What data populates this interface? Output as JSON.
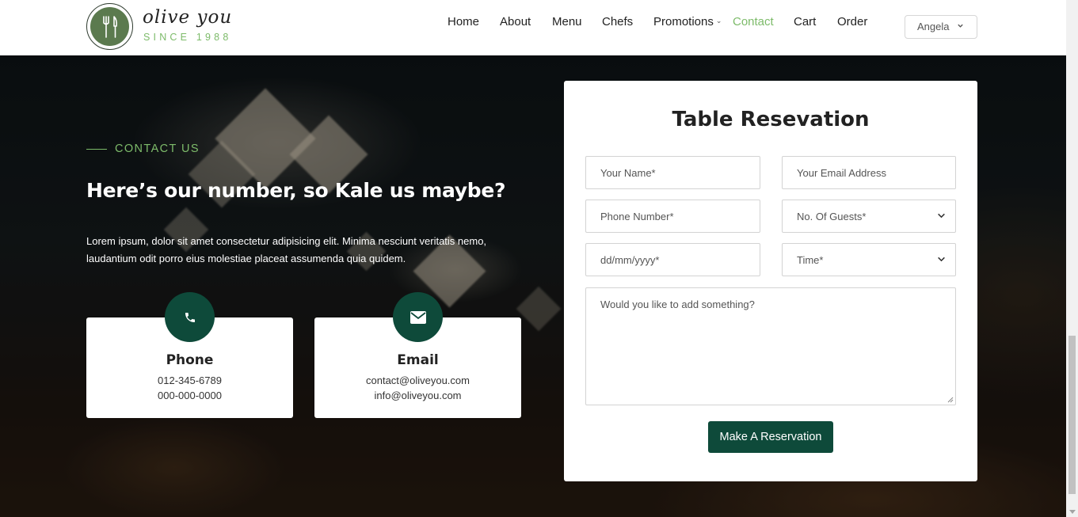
{
  "brand": {
    "name": "olive you",
    "since": "SINCE 1988"
  },
  "nav": {
    "items": [
      {
        "label": "Home"
      },
      {
        "label": "About"
      },
      {
        "label": "Menu"
      },
      {
        "label": "Chefs"
      },
      {
        "label": "Promotions",
        "has_dropdown": true
      },
      {
        "label": "Contact",
        "active": true
      },
      {
        "label": "Cart"
      },
      {
        "label": "Order"
      }
    ],
    "user_select": "Angela"
  },
  "contact": {
    "eyebrow": "CONTACT US",
    "headline": "Here’s our number, so Kale us maybe?",
    "description": "Lorem ipsum, dolor sit amet consectetur adipisicing elit. Minima nesciunt veritatis nemo, laudantium odit porro eius molestiae placeat assumenda quia quidem.",
    "cards": [
      {
        "icon": "phone-icon",
        "title": "Phone",
        "lines": [
          "012-345-6789",
          "000-000-0000"
        ]
      },
      {
        "icon": "envelope-icon",
        "title": "Email",
        "lines": [
          "contact@oliveyou.com",
          "info@oliveyou.com"
        ]
      }
    ]
  },
  "reservation": {
    "title": "Table Resevation",
    "fields": {
      "name_placeholder": "Your Name*",
      "email_placeholder": "Your Email Address",
      "phone_placeholder": "Phone Number*",
      "guests_placeholder": "No. Of Guests*",
      "date_placeholder": "dd/mm/yyyy*",
      "time_placeholder": "Time*",
      "message_placeholder": "Would you like to add something?"
    },
    "submit_label": "Make A Reservation"
  },
  "colors": {
    "accent_green": "#7dbb6a",
    "dark_green": "#0e4a3a",
    "logo_green": "#5b7a4e"
  }
}
